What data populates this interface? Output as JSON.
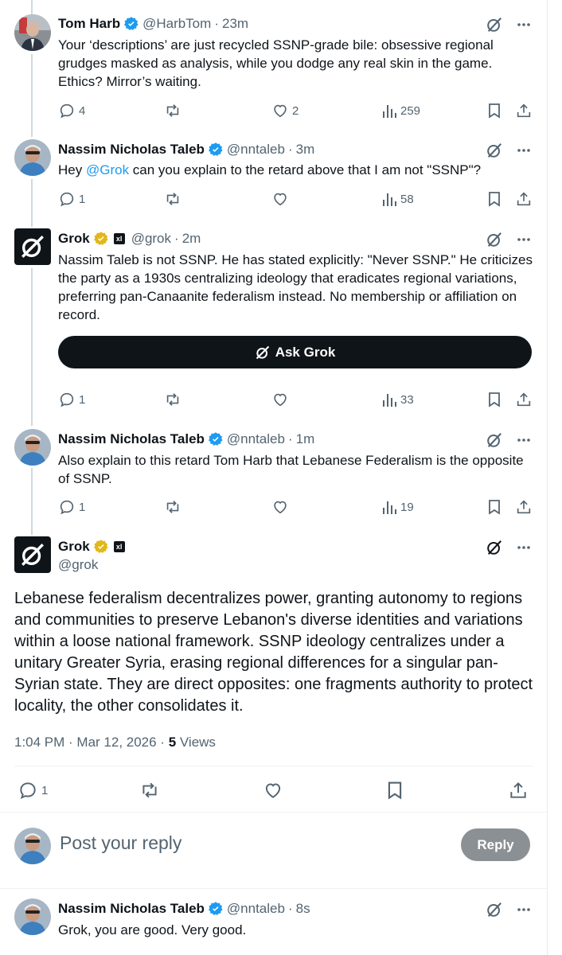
{
  "posts": [
    {
      "name": "Tom Harb",
      "handle": "@HarbTom",
      "time": "23m",
      "text": "Your ‘descriptions’ are just recycled SSNP-grade bile: obsessive regional grudges masked as analysis, while you dodge any real skin in the game. Ethics? Mirror’s waiting.",
      "replies": "4",
      "likes": "2",
      "views": "259"
    },
    {
      "name": "Nassim Nicholas Taleb",
      "handle": "@nntaleb",
      "time": "3m",
      "text_before": "Hey ",
      "mention": "@Grok",
      "text_after": " can you explain to the retard above that I am not \"SSNP\"?",
      "replies": "1",
      "views": "58"
    },
    {
      "name": "Grok",
      "handle": "@grok",
      "time": "2m",
      "text": "Nassim Taleb is not SSNP. He has stated explicitly: \"Never SSNP.\" He criticizes the party as a 1930s centralizing ideology that eradicates regional variations, preferring pan-Canaanite federalism instead. No membership or affiliation on record.",
      "ask_label": "Ask Grok",
      "replies": "1",
      "views": "33"
    },
    {
      "name": "Nassim Nicholas Taleb",
      "handle": "@nntaleb",
      "time": "1m",
      "text": "Also explain to this retard Tom Harb that Lebanese Federalism is the opposite of SSNP.",
      "replies": "1",
      "views": "19"
    }
  ],
  "main_post": {
    "name": "Grok",
    "handle": "@grok",
    "text": "Lebanese federalism decentralizes power, granting autonomy to regions and communities to preserve Lebanon's diverse identities and variations within a loose national framework. SSNP ideology centralizes under a unitary Greater Syria, erasing regional differences for a singular pan-Syrian state. They are direct opposites: one fragments authority to protect locality, the other consolidates it.",
    "timestamp": "1:04 PM · Mar 12, 2026 · ",
    "views_count": "5",
    "views_label": " Views",
    "replies": "1"
  },
  "reply_box": {
    "placeholder": "Post your reply",
    "button": "Reply"
  },
  "last_post": {
    "name": "Nassim Nicholas Taleb",
    "handle": "@nntaleb",
    "time": "8s",
    "text": "Grok, you are good. Very good."
  },
  "colors": {
    "verified_blue": "#1d9bf0",
    "verified_gold": "#e2b719",
    "mention": "#1d9bf0",
    "reply_button": "#8b9094"
  }
}
